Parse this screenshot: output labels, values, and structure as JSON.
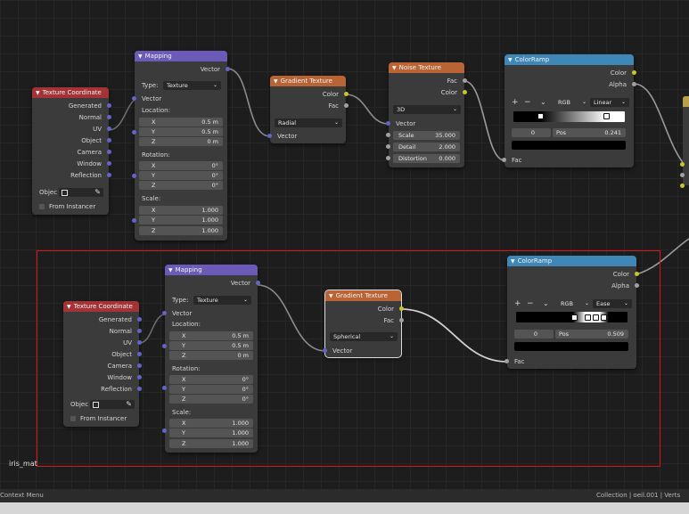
{
  "status": {
    "left": "Context Menu",
    "right": "Collection | oeil.001 | Verts"
  },
  "canvas_label": "iris_mat",
  "nodes": {
    "texcoord": {
      "title": "Texture Coordinate",
      "outputs": [
        "Generated",
        "Normal",
        "UV",
        "Object",
        "Camera",
        "Window",
        "Reflection"
      ],
      "object_label": "Objec",
      "from_instancer": "From Instancer"
    },
    "mapping": {
      "title": "Mapping",
      "output": "Vector",
      "type_label": "Type:",
      "type_value": "Texture",
      "input_vector": "Vector",
      "location_label": "Location:",
      "rotation_label": "Rotation:",
      "scale_label": "Scale:",
      "axes": [
        "X",
        "Y",
        "Z"
      ],
      "location": [
        "0.5 m",
        "0.5 m",
        "0 m"
      ],
      "rotation": [
        "0°",
        "0°",
        "0°"
      ],
      "scale": [
        "1.000",
        "1.000",
        "1.000"
      ]
    },
    "gradient_top": {
      "title": "Gradient Texture",
      "outputs": [
        "Color",
        "Fac"
      ],
      "mode": "Radial",
      "input": "Vector"
    },
    "gradient_bottom": {
      "title": "Gradient Texture",
      "outputs": [
        "Color",
        "Fac"
      ],
      "mode": "Spherical",
      "input": "Vector"
    },
    "noise": {
      "title": "Noise Texture",
      "outputs": [
        "Fac",
        "Color"
      ],
      "dimension": "3D",
      "input": "Vector",
      "params": [
        {
          "label": "Scale",
          "value": "35.000"
        },
        {
          "label": "Detail",
          "value": "2.000"
        },
        {
          "label": "Distortion",
          "value": "0.000"
        }
      ]
    },
    "ramp_top": {
      "title": "ColorRamp",
      "outputs": [
        "Color",
        "Alpha"
      ],
      "plus": "+",
      "minus": "−",
      "chevron": "⌄",
      "color_mode": "RGB",
      "interpolation": "Linear",
      "index": "0",
      "pos_label": "Pos",
      "pos_value": "0.241",
      "input": "Fac"
    },
    "ramp_bottom": {
      "title": "ColorRamp",
      "outputs": [
        "Color",
        "Alpha"
      ],
      "plus": "+",
      "minus": "−",
      "chevron": "⌄",
      "color_mode": "RGB",
      "interpolation": "Ease",
      "index": "0",
      "pos_label": "Pos",
      "pos_value": "0.509",
      "input": "Fac"
    }
  },
  "colors": {
    "texcoord_header": "#a33337",
    "mapping_header": "#6c5ab8",
    "texture_header": "#b86434",
    "colorramp_header": "#3f87b7",
    "vector_socket": "#6663c6",
    "color_socket": "#c7c729",
    "float_socket": "#a1a1a1",
    "selection_frame": "#d61717"
  }
}
